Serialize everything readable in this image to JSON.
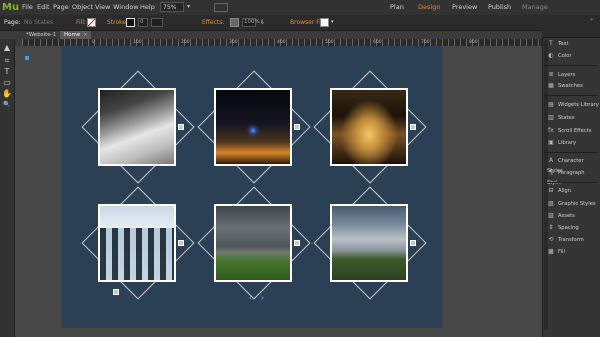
{
  "app": {
    "logo": "Mu",
    "menu": [
      "File",
      "Edit",
      "Page",
      "Object",
      "View",
      "Window",
      "Help"
    ],
    "zoom": "75%",
    "modes": [
      {
        "label": "Plan",
        "state": "normal"
      },
      {
        "label": "Design",
        "state": "active"
      },
      {
        "label": "Preview",
        "state": "normal"
      },
      {
        "label": "Publish",
        "state": "normal"
      },
      {
        "label": "Manage",
        "state": "disabled"
      }
    ]
  },
  "controlbar": {
    "page_label": "Page:",
    "page_value": "No States",
    "fill_label": "Fill:",
    "stroke_label": "Stroke:",
    "stroke_value": "0",
    "effects_label": "Effects:",
    "opacity_value": "100%",
    "browser_fill_label": "Browser Fill:"
  },
  "tabs": [
    {
      "label": "*Website-1",
      "close": "×",
      "active": false
    },
    {
      "label": "Home",
      "close": "×",
      "active": true
    }
  ],
  "ruler": {
    "marks": [
      "0",
      "100",
      "200",
      "300",
      "400",
      "500",
      "600",
      "700",
      "800"
    ]
  },
  "tools": [
    "selection-tool",
    "crop-tool",
    "text-tool",
    "rectangle-tool",
    "hand-tool",
    "zoom-tool"
  ],
  "tool_glyphs": [
    "▲",
    "⌗",
    "T",
    "▭",
    "✋",
    "🔍"
  ],
  "gallery": {
    "items": [
      {
        "name": "snowy-mountain",
        "colors": [
          "#2c2c2c",
          "#9a9a9a",
          "#e6e6e6"
        ]
      },
      {
        "name": "night-street",
        "colors": [
          "#0c0c14",
          "#4b3520",
          "#d7862a"
        ]
      },
      {
        "name": "glowing-jars",
        "colors": [
          "#1a120a",
          "#7a5225",
          "#f0c060"
        ]
      },
      {
        "name": "snowy-forest",
        "colors": [
          "#d7e4ee",
          "#3b4f5c",
          "#f2f6f8"
        ]
      },
      {
        "name": "storm-field-1",
        "colors": [
          "#4f565b",
          "#6e7a70",
          "#45762b"
        ]
      },
      {
        "name": "storm-field-2",
        "colors": [
          "#7a8a9e",
          "#b8c2c8",
          "#3e5a2a"
        ]
      }
    ],
    "nav": {
      "prev": "‹",
      "next": "›"
    }
  },
  "panel": {
    "groups": [
      [
        {
          "icon": "T",
          "label": "Text"
        },
        {
          "icon": "◐",
          "label": "Color"
        }
      ],
      [
        {
          "icon": "≣",
          "label": "Layers"
        },
        {
          "icon": "▦",
          "label": "Swatches"
        }
      ],
      [
        {
          "icon": "▤",
          "label": "Widgets Library"
        },
        {
          "icon": "▥",
          "label": "States"
        },
        {
          "icon": "fx",
          "label": "Scroll Effects"
        },
        {
          "icon": "▣",
          "label": "Library"
        }
      ],
      [
        {
          "icon": "A",
          "label": "Character Styles"
        },
        {
          "icon": "¶",
          "label": "Paragraph Styl..."
        }
      ],
      [
        {
          "icon": "⊟",
          "label": "Align"
        },
        {
          "icon": "▧",
          "label": "Graphic Styles"
        },
        {
          "icon": "▨",
          "label": "Assets"
        },
        {
          "icon": "⇕",
          "label": "Spacing"
        },
        {
          "icon": "⟲",
          "label": "Transform"
        },
        {
          "icon": "▩",
          "label": "Fill"
        }
      ]
    ]
  },
  "colors": {
    "accent": "#e8892a",
    "canvas": "#2b3f55",
    "workspace": "#474747",
    "logo": "#7fb520"
  }
}
